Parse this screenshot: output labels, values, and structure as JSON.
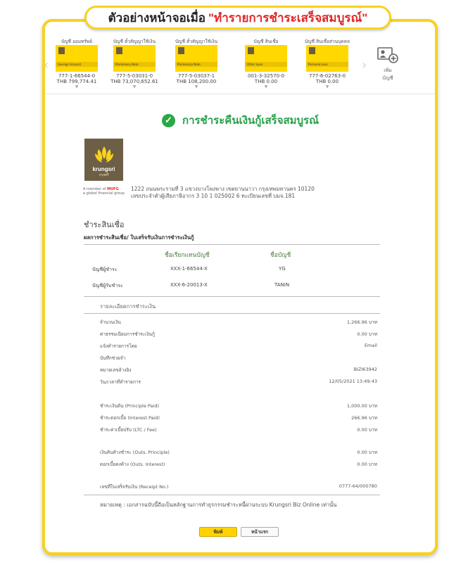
{
  "banner": {
    "prefix": "ตัวอย่างหน้าจอเมื่อ",
    "highlight": "\"ทำรายการชำระเสร็จสมบูรณ์\""
  },
  "accounts": [
    {
      "type": "บัญชี ออมทรัพย์",
      "card_label": "Savings Account",
      "number": "777-1-66544-0",
      "balance": "THB 799,774.41"
    },
    {
      "type": "บัญชี ตั๋วสัญญาใช้เงิน",
      "card_label": "Promissory Note",
      "number": "777-5-03031-0",
      "balance": "THB 73,070,652.61"
    },
    {
      "type": "บัญชี ตั๋วสัญญาใช้เงิน",
      "card_label": "Promissory Note",
      "number": "777-5-03037-1",
      "balance": "THB 108,200.00"
    },
    {
      "type": "บัญชี สินเชื่อ",
      "card_label": "Other Loan",
      "number": "001-3-32570-0",
      "balance": "THB 0.00"
    },
    {
      "type": "บัญชี สินเชื่อส่วนบุคคล",
      "card_label": "Personal Loan",
      "number": "777-6-02763-0",
      "balance": "THB 0.00"
    }
  ],
  "add_account": {
    "line1": "เพิ่ม",
    "line2": "บัญชี"
  },
  "success_text": "การชำระคืนเงินกู้เสร็จสมบูรณ์",
  "brand": {
    "name": "krungsri",
    "sub": "กรุงศรี",
    "group_prefix": "A member of",
    "group_brand": "MUFG",
    "group_suffix": "a global financial group"
  },
  "address": {
    "line1": "1222 ถนนพระรามที่ 3 แขวงบางโพงพาง เขตยานนาวา กรุงเทพมหานคร 10120",
    "line2": "เลขประจำตัวผู้เสียภาษีอากร 3 10 1 025002 6 ทะเบียนเลขที่ บมจ.181"
  },
  "section_title": "ชำระสินเชื่อ",
  "sub_title": "ผลการชำระสินเชื่อ/ ใบเสร็จรับเงินการชำระเงินกู้",
  "table": {
    "headers": [
      "ชื่อเรียกแทนบัญชี",
      "ชื่อบัญชี"
    ],
    "rows": [
      {
        "label": "บัญชีผู้ชำระ",
        "alias": "XXX-1-66544-X",
        "name": "YG"
      },
      {
        "label": "บัญชีผู้รับชำระ",
        "alias": "XXX-6-20013-X",
        "name": "TANIN"
      }
    ]
  },
  "detail_title": "รายละเอียดการชำระเงิน",
  "details": [
    {
      "label": "จำนวนเงิน",
      "value": "1,266.96 บาท"
    },
    {
      "label": "ค่าธรรมเนียมการชำระเงินกู้",
      "value": "0.00 บาท"
    },
    {
      "label": "แจ้งทำรายการโดย",
      "value": "Email"
    },
    {
      "label": "บันทึกช่วยจำ",
      "value": ""
    },
    {
      "label": "หมายเลขอ้างอิง",
      "value": "BIZI63942"
    },
    {
      "label": "วัน/เวลาที่ทำรายการ",
      "value": "12/05/2021 13:49:43"
    },
    {
      "label": "ชำระเงินต้น (Principle Paid)",
      "value": "1,000.00 บาท"
    },
    {
      "label": "ชำระดอกเบี้ย (Interest Paid)",
      "value": "266.96 บาท"
    },
    {
      "label": "ชำระค่าเบี้ยปรับ (LTC / Fee)",
      "value": "0.00 บาท"
    },
    {
      "label": "เงินต้นค้างชำระ (Outs. Principle)",
      "value": "0.00 บาท"
    },
    {
      "label": "ดอกเบี้ยคงค้าง (Outs. Interest)",
      "value": "0.00 บาท"
    },
    {
      "label": "เลขที่ใบเสร็จรับเงิน (Receipt No.)",
      "value": "0777-64/000780"
    }
  ],
  "note": "หมายเหตุ : เอกสารฉบับนี้ถือเป็นหลักฐานการทำธุรกรรมชำระหนี้ผ่านระบบ Krungsri Biz Online เท่านั้น",
  "buttons": {
    "print": "พิมพ์",
    "home": "หน้าแรก"
  },
  "colors": {
    "accent": "#f7d21f",
    "success": "#27a04a",
    "brand": "#6d5f46",
    "highlight": "#e02828"
  }
}
